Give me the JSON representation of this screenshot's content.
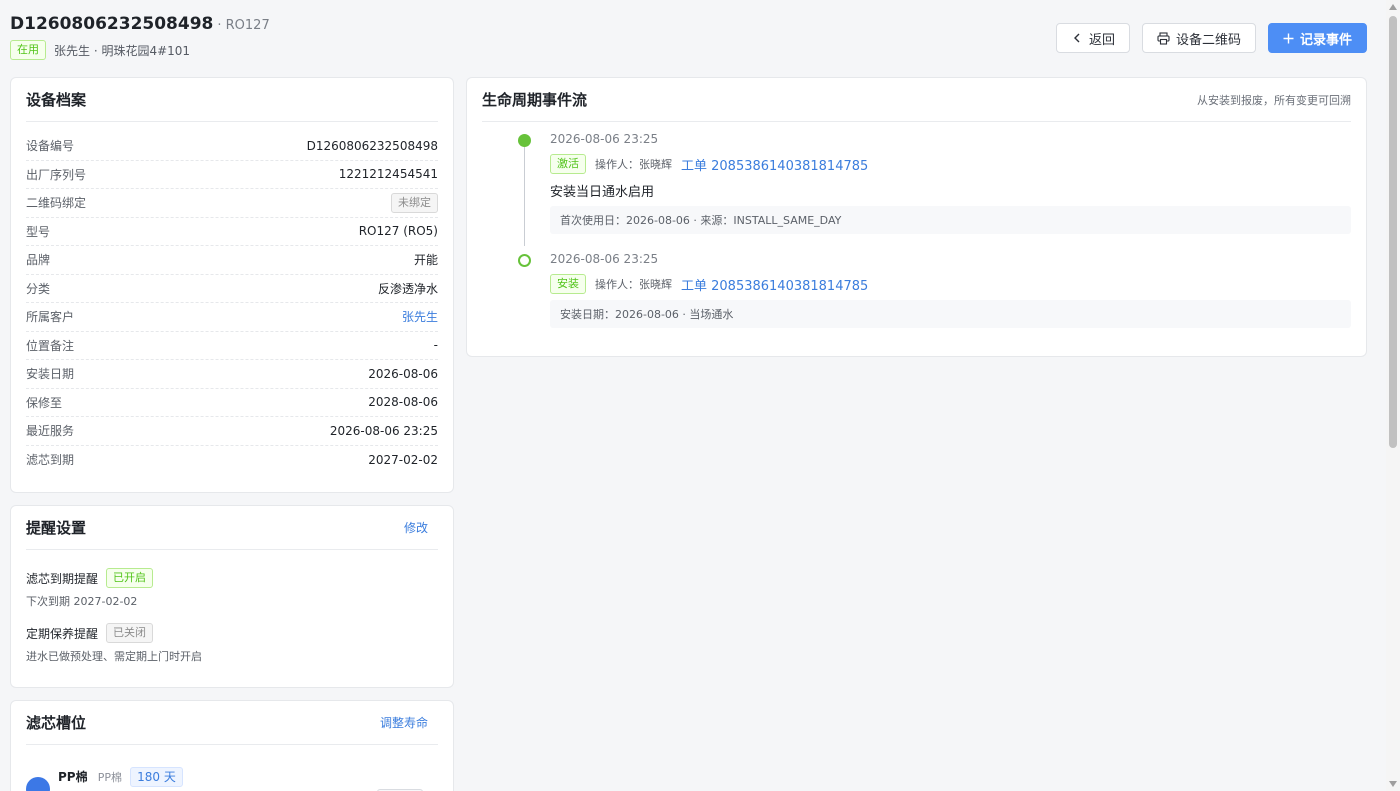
{
  "header": {
    "device_id": "D1260806232508498",
    "model_suffix": "· RO127",
    "status": "在用",
    "customer_location": "张先生 · 明珠花园4#101",
    "back_label": "返回",
    "qrcode_label": "设备二维码",
    "record_label": "记录事件"
  },
  "profile": {
    "title": "设备档案",
    "rows": [
      {
        "k": "设备编号",
        "v": "D1260806232508498"
      },
      {
        "k": "出厂序列号",
        "v": "1221212454541"
      },
      {
        "k": "二维码绑定",
        "v": "未绑定"
      },
      {
        "k": "型号",
        "v": "RO127 (RO5)"
      },
      {
        "k": "品牌",
        "v": "开能"
      },
      {
        "k": "分类",
        "v": "反渗透净水"
      },
      {
        "k": "所属客户",
        "v": "张先生"
      },
      {
        "k": "位置备注",
        "v": "-"
      },
      {
        "k": "安装日期",
        "v": "2026-08-06"
      },
      {
        "k": "保修至",
        "v": "2028-08-06"
      },
      {
        "k": "最近服务",
        "v": "2026-08-06 23:25"
      },
      {
        "k": "滤芯到期",
        "v": "2027-02-02"
      }
    ]
  },
  "reminder": {
    "title": "提醒设置",
    "edit_label": "修改",
    "items": [
      {
        "name": "滤芯到期提醒",
        "status": "已开启",
        "desc": "下次到期 2027-02-02"
      },
      {
        "name": "定期保养提醒",
        "status": "已关闭",
        "desc": "进水已做预处理、需定期上门时开启"
      }
    ]
  },
  "filters": {
    "title": "滤芯槽位",
    "adjust_label": "调整寿命",
    "slot": {
      "name": "PP棉",
      "type": "PP棉",
      "life": "180 天"
    }
  },
  "lifecycle": {
    "title": "生命周期事件流",
    "note": "从安装到报废，所有变更可回溯",
    "events": [
      {
        "time": "2026-08-06 23:25",
        "tag": "激活",
        "operator": "操作人：张晓辉",
        "ticket": "工单 2085386140381814785",
        "desc": "安装当日通水启用",
        "detail": "首次使用日：2026-08-06 · 来源：INSTALL_SAME_DAY"
      },
      {
        "time": "2026-08-06 23:25",
        "tag": "安装",
        "operator": "操作人：张晓辉",
        "ticket": "工单 2085386140381814785",
        "detail": "安装日期：2026-08-06 · 当场通水"
      }
    ]
  },
  "icons": {
    "back": "chevron-left-icon",
    "print": "printer-icon",
    "add": "plus-icon"
  },
  "colors": {
    "primary": "#4d8ef5",
    "link": "#3b7ddd",
    "success": "#67c23a"
  }
}
